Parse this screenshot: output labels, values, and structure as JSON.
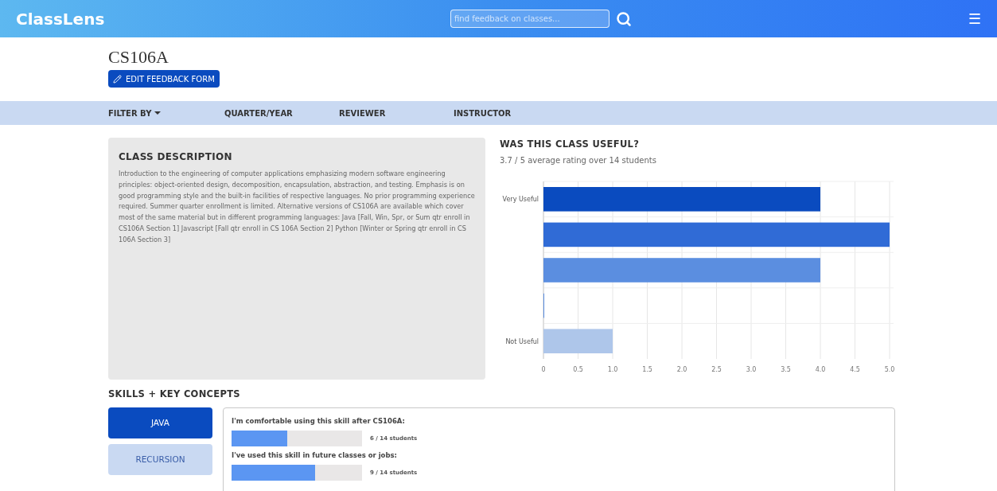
{
  "header": {
    "logo": "ClassLens",
    "search": {
      "placeholder": "find feedback on classes..."
    },
    "menu_icon": "☰"
  },
  "course": {
    "title": "CS106A",
    "edit_button": "EDIT FEEDBACK FORM"
  },
  "filter_bar": {
    "label": "FILTER BY",
    "items": [
      "QUARTER/YEAR",
      "REVIEWER",
      "INSTRUCTOR"
    ]
  },
  "description": {
    "heading": "CLASS DESCRIPTION",
    "text": "Introduction to the engineering of computer applications emphasizing modern software engineering principles: object-oriented design, decomposition, encapsulation, abstraction, and testing. Emphasis is on good programming style and the built-in facilities of respective languages. No prior programming experience required. Summer quarter enrollment is limited. Alternative versions of CS106A are available which cover most of the same material but in different programming languages: Java [Fall, Win, Spr, or Sum qtr enroll in CS106A Section 1] Javascript [Fall qtr enroll in CS 106A Section 2] Python [Winter or Spring qtr enroll in CS 106A Section 3]"
  },
  "usefulness": {
    "heading": "WAS THIS CLASS USEFUL?",
    "summary": "3.7 / 5 average rating over 14 students",
    "chart_data": {
      "type": "bar",
      "orientation": "horizontal",
      "grid": true,
      "categories": [
        "Very Useful",
        null,
        null,
        null,
        "Not Useful"
      ],
      "values": [
        4,
        5,
        4,
        0,
        1
      ],
      "colors": [
        "#0a4bbf",
        "#306bd6",
        "#5b8ee0",
        "#5b8ee0",
        "#aec6ea"
      ],
      "xlim": [
        0,
        5
      ],
      "xticks": [
        {
          "value": 0,
          "label": "0"
        },
        {
          "value": 0.5,
          "label": "0.5"
        },
        {
          "value": 1,
          "label": "1.0"
        },
        {
          "value": 1.5,
          "label": "1.5"
        },
        {
          "value": 2,
          "label": "2.0"
        },
        {
          "value": 2.5,
          "label": "2.5"
        },
        {
          "value": 3,
          "label": "3.0"
        },
        {
          "value": 3.5,
          "label": "3.5"
        },
        {
          "value": 4,
          "label": "4.0"
        },
        {
          "value": 4.5,
          "label": "4.5"
        },
        {
          "value": 5,
          "label": "5.0"
        }
      ]
    }
  },
  "skills": {
    "heading": "SKILLS + KEY CONCEPTS",
    "tabs": [
      {
        "label": "JAVA",
        "selected": true
      },
      {
        "label": "RECURSION",
        "selected": false
      }
    ],
    "questions": [
      {
        "question": "I'm comfortable using this skill after CS106A:",
        "level": 0.4286,
        "reading": "6 / 14 students"
      },
      {
        "question": "I've used this skill in future classes or jobs:",
        "level": 0.6429,
        "reading": "9 / 14 students"
      }
    ]
  }
}
